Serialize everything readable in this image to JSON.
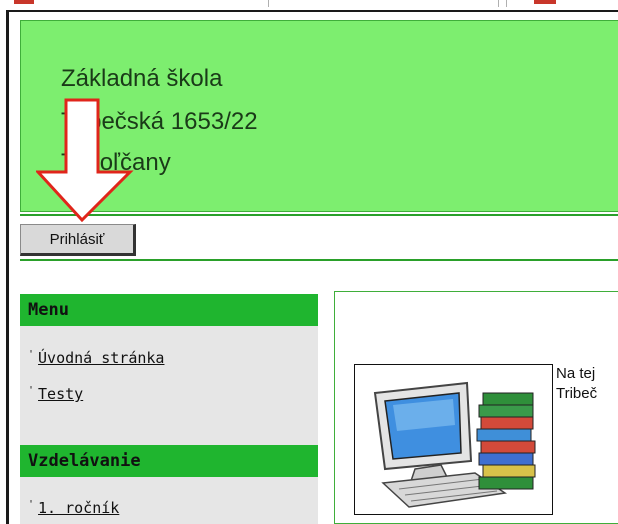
{
  "header": {
    "line1": "Základná škola",
    "line2": "Tribečská 1653/22",
    "line3": "Topoľčany"
  },
  "login_button": "Prihlásiť",
  "sidebar": {
    "menu_title": "Menu",
    "menu_items": [
      {
        "label": "Úvodná stránka"
      },
      {
        "label": "Testy"
      }
    ],
    "education_title": "Vzdelávanie",
    "education_items": [
      {
        "label": "1. ročník"
      }
    ],
    "bullet": "'"
  },
  "content": {
    "text_line1": "Na tej",
    "text_line2": "Tribeč"
  },
  "colors": {
    "header_bg": "#7dee6f",
    "sidebar_head": "#1fb52f",
    "arrow": "#e0251b"
  },
  "icons": {
    "arrow": "down-arrow-icon",
    "illustration": "computer-books-icon"
  }
}
